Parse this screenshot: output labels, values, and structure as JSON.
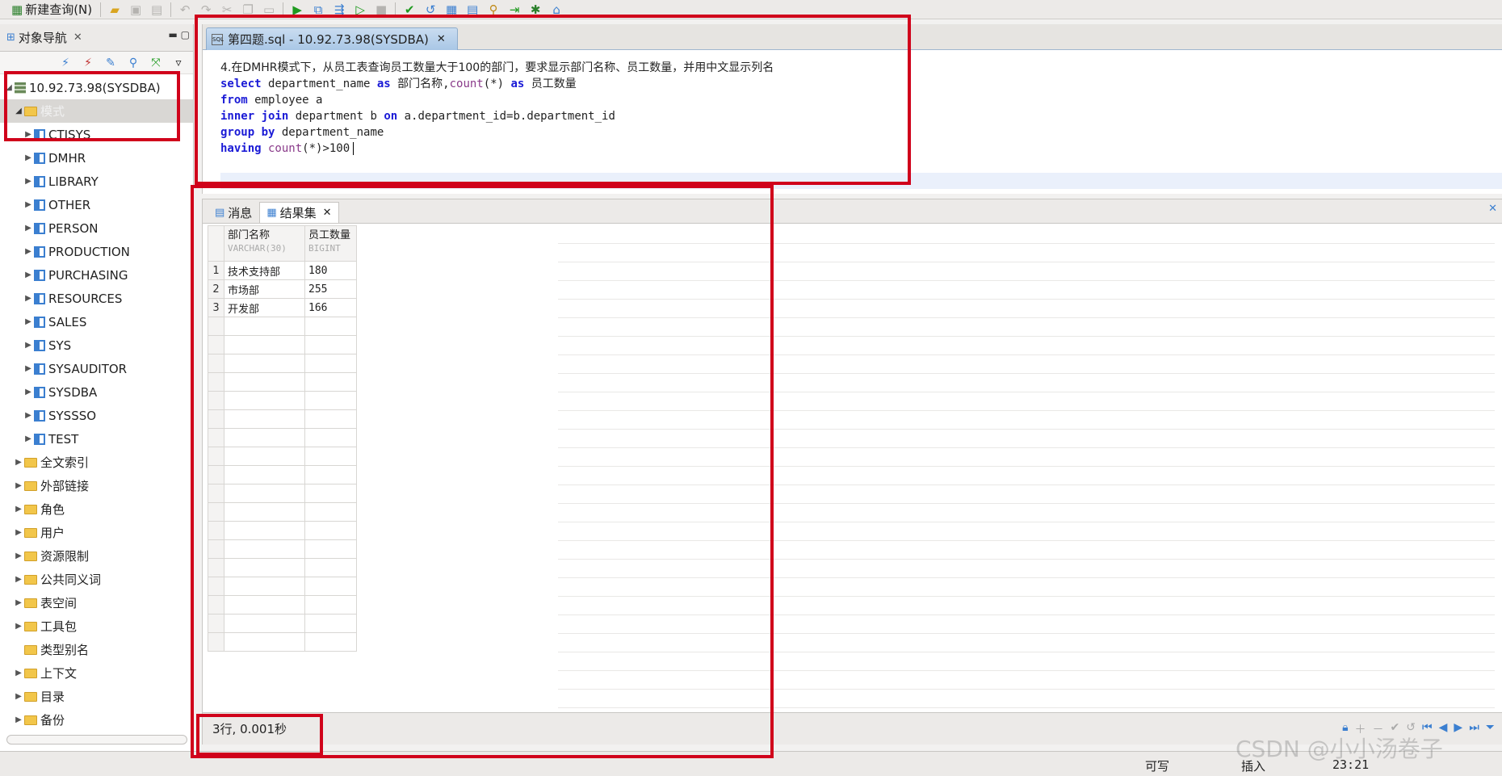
{
  "toolbar": {
    "new_query_label": "新建查询(N)",
    "icons": [
      "open-folder-icon",
      "save-icon",
      "save-all-icon",
      "undo-icon",
      "redo-icon",
      "cut-icon",
      "copy-icon",
      "paste-icon",
      "run-icon",
      "run-explain-icon",
      "run-step-icon",
      "execute-script-icon",
      "stop-icon",
      "commit-icon",
      "rollback-icon",
      "plan-icon",
      "options-icon",
      "debug-search-icon",
      "run-to-icon",
      "bug-icon",
      "home-icon"
    ]
  },
  "navigator": {
    "title": "对象导航",
    "connection": "10.92.73.98(SYSDBA)",
    "schema_folder": "模式",
    "schemas": [
      "CTISYS",
      "DMHR",
      "LIBRARY",
      "OTHER",
      "PERSON",
      "PRODUCTION",
      "PURCHASING",
      "RESOURCES",
      "SALES",
      "SYS",
      "SYSAUDITOR",
      "SYSDBA",
      "SYSSSO",
      "TEST"
    ],
    "folders": [
      "全文索引",
      "外部链接",
      "角色",
      "用户",
      "资源限制",
      "公共同义词",
      "表空间",
      "工具包",
      "类型别名",
      "上下文",
      "目录",
      "备份"
    ]
  },
  "editor": {
    "tab_title": "第四题.sql - 10.92.73.98(SYSDBA)",
    "comment": "4.在DMHR模式下，从员工表查询员工数量大于100的部门，要求显示部门名称、员工数量，并用中文显示列名",
    "line1": {
      "kw1": "select",
      "t1": " department_name ",
      "kw2": "as",
      "t2": " 部门名称,",
      "fn": "count",
      "t3": "(*) ",
      "kw3": "as",
      "t4": " 员工数量"
    },
    "line2": {
      "kw": "from",
      "t": " employee a"
    },
    "line3": {
      "kw": "inner join",
      "t1": " department b ",
      "kw2": "on",
      "t2": " a.department_id=b.department_id"
    },
    "line4": {
      "kw": "group by",
      "t": " department_name"
    },
    "line5": {
      "kw": "having",
      "fn": " count",
      "t": "(*)>100"
    }
  },
  "results": {
    "tab_messages": "消息",
    "tab_resultset": "结果集",
    "columns": [
      {
        "name": "部门名称",
        "type": "VARCHAR(30)"
      },
      {
        "name": "员工数量",
        "type": "BIGINT"
      }
    ],
    "rows": [
      {
        "n": "1",
        "dept": "技术支持部",
        "count": "180"
      },
      {
        "n": "2",
        "dept": "市场部",
        "count": "255"
      },
      {
        "n": "3",
        "dept": "开发部",
        "count": "166"
      }
    ],
    "status": "3行, 0.001秒"
  },
  "statusbar": {
    "writable": "可写",
    "insert": "插入",
    "position": "23:21"
  },
  "watermark": "CSDN @小小汤卷子",
  "colors": {
    "highlight_box": "#d0021b",
    "keyword": "#1a1ad6",
    "function": "#8a3b8a",
    "tab_active": "#a9c7e6"
  }
}
